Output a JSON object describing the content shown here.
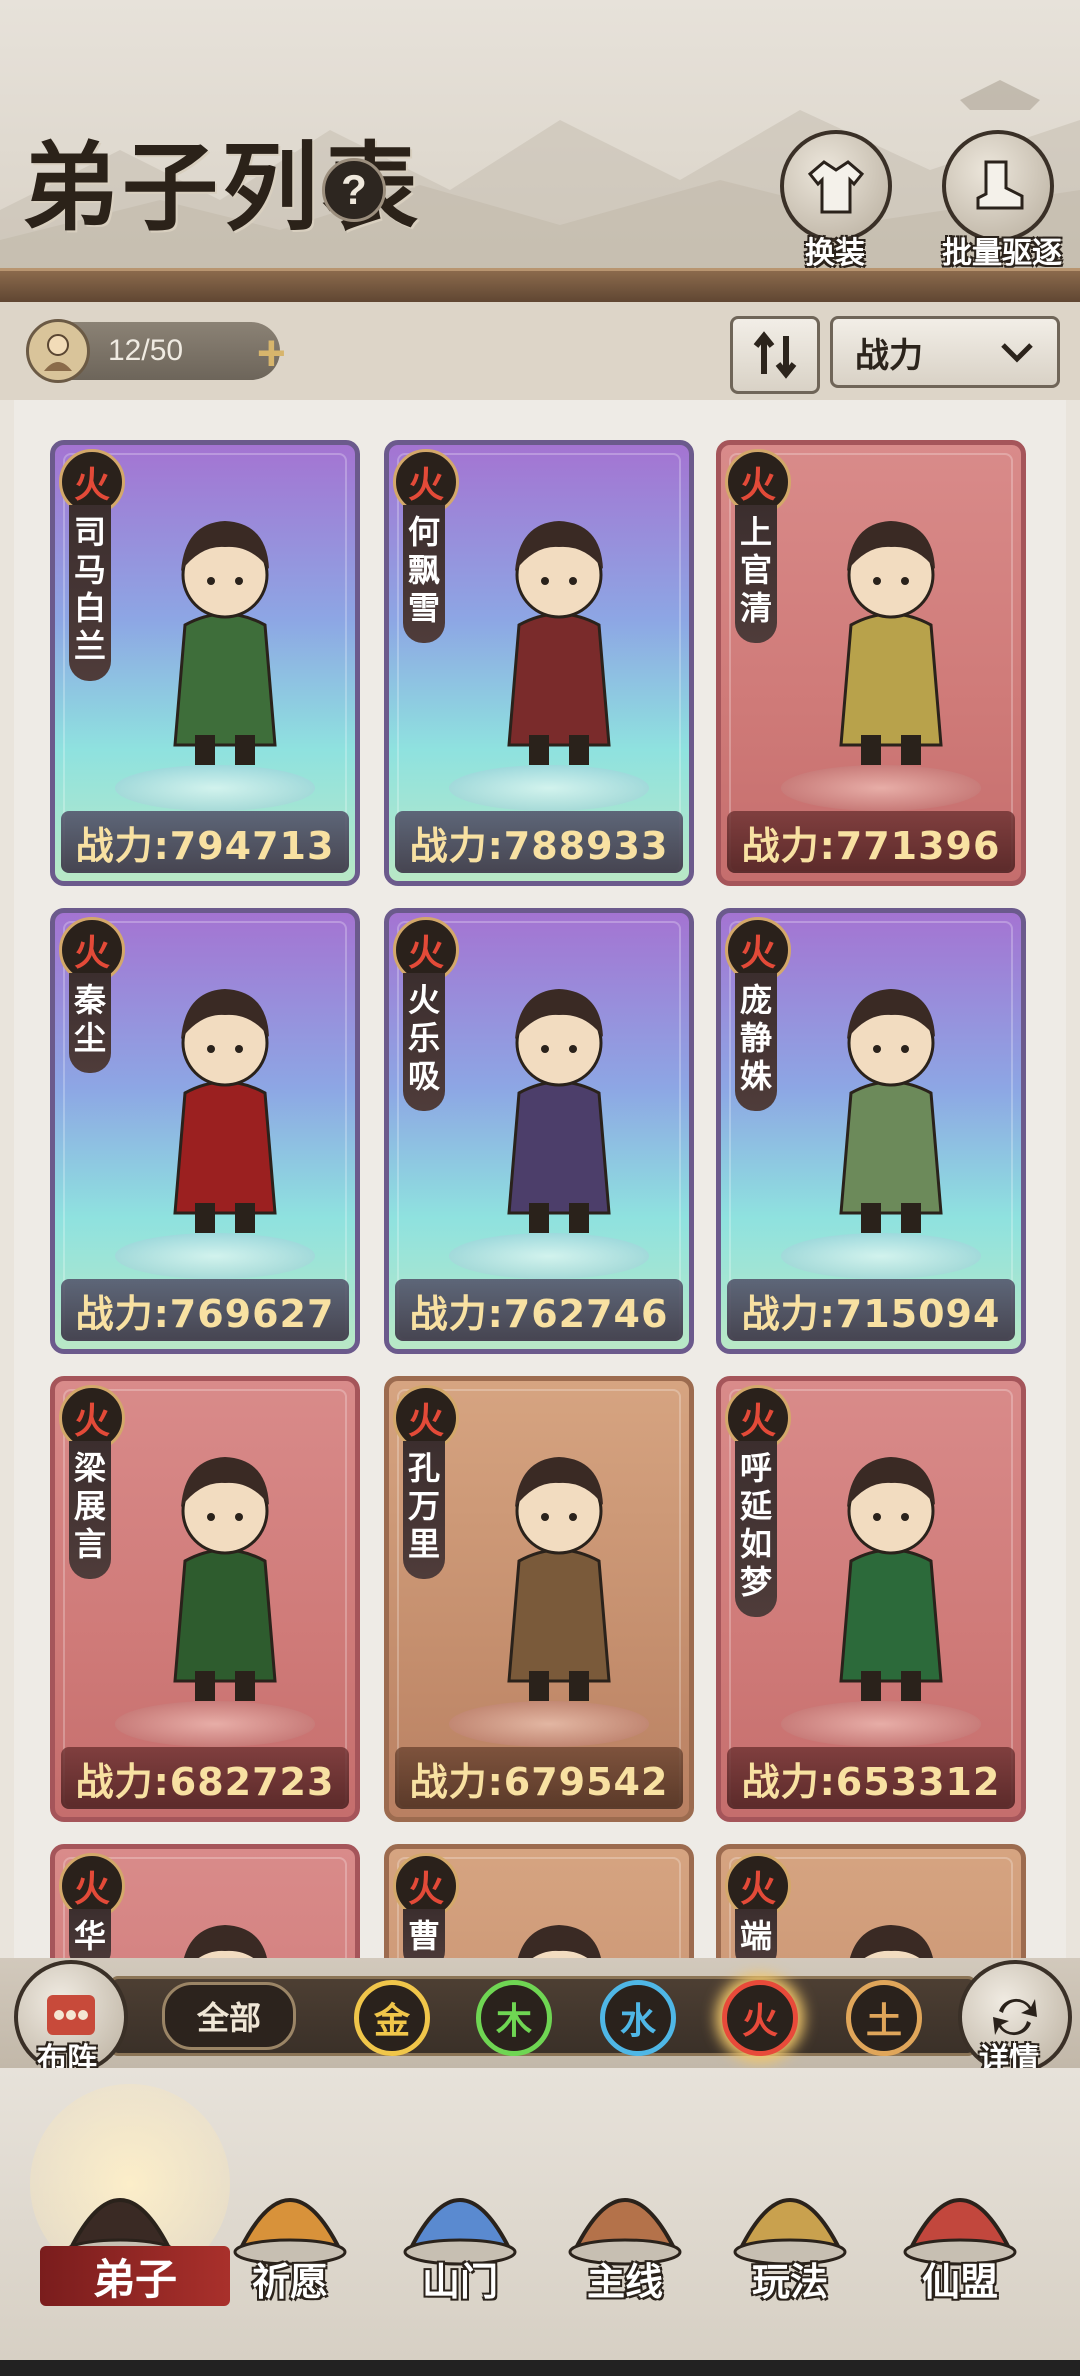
{
  "header": {
    "title": "弟子列表",
    "help": "?",
    "actions": [
      {
        "label": "换装",
        "icon": "robe-icon"
      },
      {
        "label": "批量驱逐",
        "icon": "boot-icon"
      }
    ]
  },
  "toolbar": {
    "count": "12/50",
    "sort_icon": "sort-arrows-icon",
    "sort_select": "战力"
  },
  "cards": [
    {
      "element": "火",
      "name": [
        "司",
        "马",
        "白",
        "兰"
      ],
      "power": "战力:794713",
      "rarity": "purple"
    },
    {
      "element": "火",
      "name": [
        "何",
        "飘",
        "雪"
      ],
      "power": "战力:788933",
      "rarity": "purple"
    },
    {
      "element": "火",
      "name": [
        "上",
        "官",
        "清"
      ],
      "power": "战力:771396",
      "rarity": "red"
    },
    {
      "element": "火",
      "name": [
        "秦",
        "尘"
      ],
      "power": "战力:769627",
      "rarity": "purple"
    },
    {
      "element": "火",
      "name": [
        "火",
        "乐",
        "吸"
      ],
      "power": "战力:762746",
      "rarity": "purple"
    },
    {
      "element": "火",
      "name": [
        "庞",
        "静",
        "姝"
      ],
      "power": "战力:715094",
      "rarity": "purple"
    },
    {
      "element": "火",
      "name": [
        "梁",
        "展",
        "言"
      ],
      "power": "战力:682723",
      "rarity": "red"
    },
    {
      "element": "火",
      "name": [
        "孔",
        "万",
        "里"
      ],
      "power": "战力:679542",
      "rarity": "brown"
    },
    {
      "element": "火",
      "name": [
        "呼",
        "延",
        "如",
        "梦"
      ],
      "power": "战力:653312",
      "rarity": "red"
    },
    {
      "element": "火",
      "name": [
        "华"
      ],
      "power": "",
      "rarity": "red"
    },
    {
      "element": "火",
      "name": [
        "曹"
      ],
      "power": "",
      "rarity": "brown"
    },
    {
      "element": "火",
      "name": [
        "端"
      ],
      "power": "",
      "rarity": "brown"
    }
  ],
  "filters": {
    "formation": "布阵",
    "all": "全部",
    "elements": [
      {
        "label": "金",
        "color": "#f0c64a"
      },
      {
        "label": "木",
        "color": "#6fd653"
      },
      {
        "label": "水",
        "color": "#4fb7e6"
      },
      {
        "label": "火",
        "color": "#e84a3a"
      },
      {
        "label": "土",
        "color": "#e0a65a"
      }
    ],
    "details": "详情"
  },
  "nav": [
    {
      "label": "弟子",
      "active": true
    },
    {
      "label": "祈愿"
    },
    {
      "label": "山门"
    },
    {
      "label": "主线"
    },
    {
      "label": "玩法"
    },
    {
      "label": "仙盟"
    }
  ]
}
